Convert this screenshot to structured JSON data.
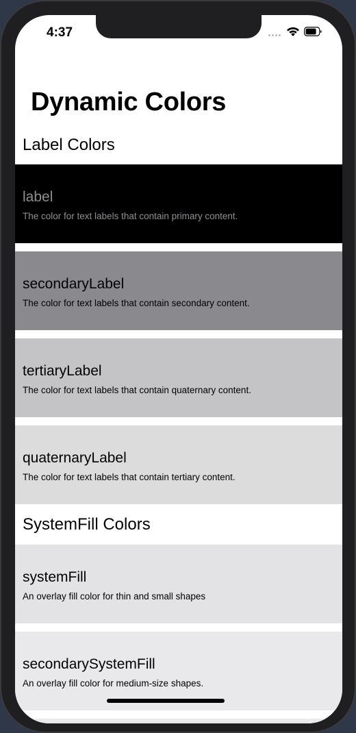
{
  "status_bar": {
    "time": "4:37"
  },
  "page": {
    "title": "Dynamic Colors"
  },
  "sections": [
    {
      "header": "Label Colors",
      "rows": [
        {
          "title": "label",
          "description": "The color for text labels that contain primary content.",
          "background": "#000000",
          "text_color": "#8e8e93"
        },
        {
          "title": "secondaryLabel",
          "description": "The color for text labels that contain secondary content.",
          "background": "#8a8a8e",
          "text_color": "#000000"
        },
        {
          "title": "tertiaryLabel",
          "description": "The color for text labels that contain quaternary content.",
          "background": "#c4c4c6",
          "text_color": "#000000"
        },
        {
          "title": "quaternaryLabel",
          "description": "The color for text labels that contain tertiary content.",
          "background": "#dcdcdd",
          "text_color": "#000000"
        }
      ]
    },
    {
      "header": "SystemFill Colors",
      "rows": [
        {
          "title": "systemFill",
          "description": "An overlay fill color for thin and small shapes",
          "background": "#e3e3e5",
          "text_color": "#000000"
        },
        {
          "title": "secondarySystemFill",
          "description": "An overlay fill color for medium-size shapes.",
          "background": "#e9e9eb",
          "text_color": "#000000"
        }
      ]
    }
  ]
}
